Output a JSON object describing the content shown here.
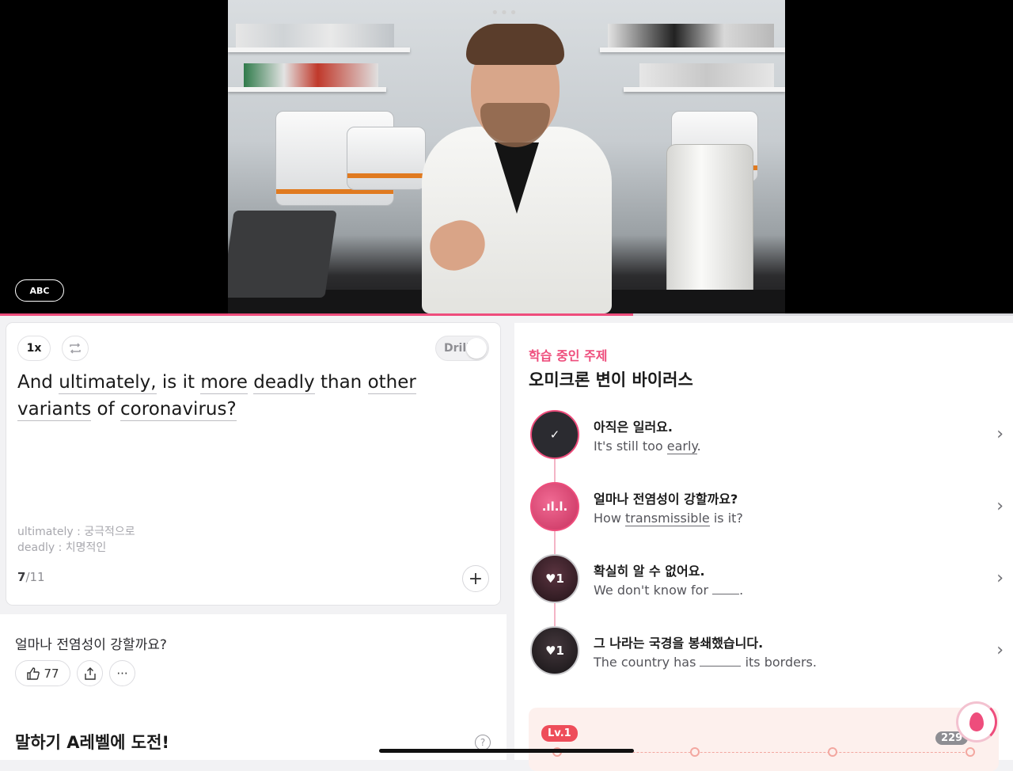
{
  "video": {
    "abc_label": "ABC",
    "progress": 0.625
  },
  "card": {
    "speed_label": "1x",
    "drill_label": "Drill",
    "sentence_words": [
      "And",
      "ultimately,",
      "is",
      "it",
      "more",
      "deadly",
      "than",
      "other",
      "variants",
      "of",
      "coronavirus?"
    ],
    "vocab": [
      "ultimately : 궁극적으로",
      "deadly : 치명적인"
    ],
    "counter_current": "7",
    "counter_total": "/11"
  },
  "lower": {
    "translation": "얼마나 전염성이 강할까요?",
    "like_count": "77",
    "challenge_title": "말하기 A레벨에 도전!",
    "help_label": "?"
  },
  "topic": {
    "label": "학습 중인 주제",
    "title": "오미크론 변이 바이러스",
    "items": [
      {
        "kr": "아직은 일러요.",
        "en_pre": "It's still too ",
        "en_u": "early",
        "en_post": ".",
        "badge": "✓"
      },
      {
        "kr": "얼마나 전염성이 강할까요?",
        "en_pre": "How ",
        "en_u": "transmissible",
        "en_post": " is it?",
        "badge": ".ıl.l."
      },
      {
        "kr": "확실히 알 수 없어요.",
        "en_pre": "We don't know for ",
        "en_u": "",
        "en_post": ".",
        "badge": "♥1"
      },
      {
        "kr": "그 나라는 국경을 봉쇄했습니다.",
        "en_pre": "The country has ",
        "en_u": "",
        "en_post": " its borders.",
        "badge": "♥1"
      }
    ]
  },
  "level": {
    "label": "Lv.1",
    "points": "229"
  },
  "colors": {
    "accent": "#ee4d7c"
  }
}
